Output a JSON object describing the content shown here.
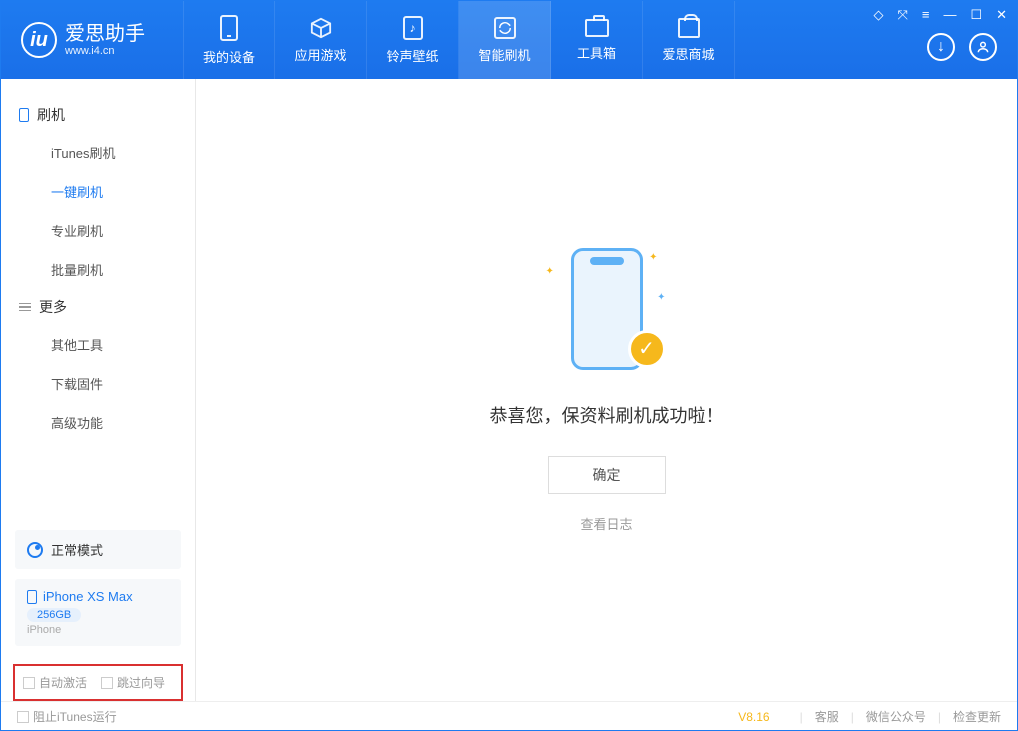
{
  "app": {
    "title": "爱思助手",
    "url": "www.i4.cn"
  },
  "nav": {
    "tabs": [
      {
        "label": "我的设备"
      },
      {
        "label": "应用游戏"
      },
      {
        "label": "铃声壁纸"
      },
      {
        "label": "智能刷机"
      },
      {
        "label": "工具箱"
      },
      {
        "label": "爱思商城"
      }
    ]
  },
  "sidebar": {
    "group1_title": "刷机",
    "items1": [
      {
        "label": "iTunes刷机"
      },
      {
        "label": "一键刷机"
      },
      {
        "label": "专业刷机"
      },
      {
        "label": "批量刷机"
      }
    ],
    "group2_title": "更多",
    "items2": [
      {
        "label": "其他工具"
      },
      {
        "label": "下载固件"
      },
      {
        "label": "高级功能"
      }
    ],
    "mode_label": "正常模式",
    "device": {
      "name": "iPhone XS Max",
      "storage": "256GB",
      "type": "iPhone"
    },
    "checkbox1": "自动激活",
    "checkbox2": "跳过向导"
  },
  "main": {
    "success_text": "恭喜您，保资料刷机成功啦！",
    "ok_button": "确定",
    "view_log": "查看日志"
  },
  "footer": {
    "block_itunes": "阻止iTunes运行",
    "version": "V8.16",
    "link_service": "客服",
    "link_wechat": "微信公众号",
    "link_update": "检查更新"
  }
}
